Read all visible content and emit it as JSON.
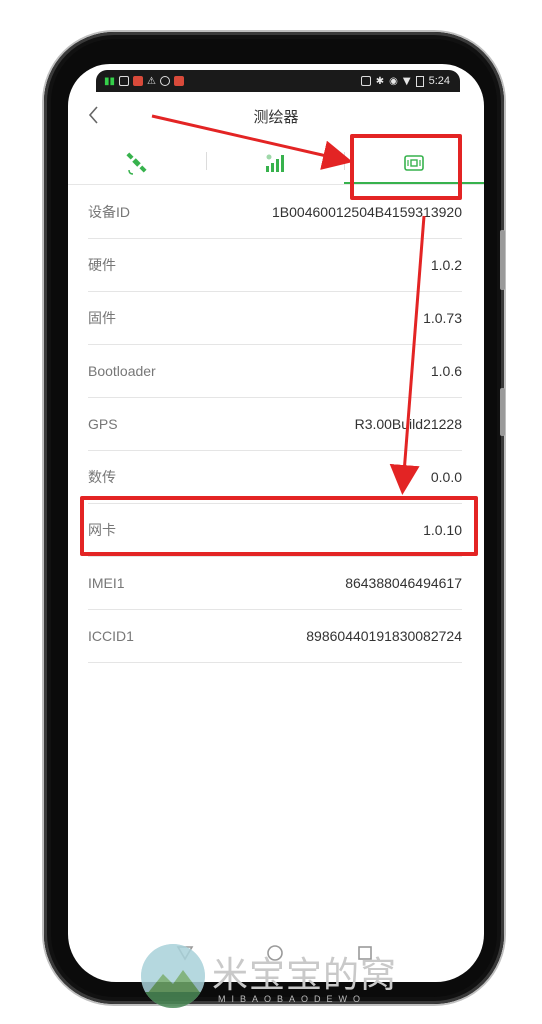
{
  "status_bar": {
    "time": "5:24",
    "left_icons": [
      "signal-icon",
      "wifi-icon",
      "notification-icon",
      "alert-icon",
      "sync-icon",
      "app-icon"
    ],
    "right_icons": [
      "nfc-icon",
      "bluetooth-icon",
      "location-icon",
      "wifi-icon",
      "battery-icon"
    ]
  },
  "header": {
    "title": "测绘器",
    "back_icon": "chevron-left-icon"
  },
  "tabs": [
    {
      "icon": "satellite-icon",
      "active": false
    },
    {
      "icon": "signal-bars-icon",
      "active": false
    },
    {
      "icon": "device-chip-icon",
      "active": true
    }
  ],
  "accent_color": "#37b24d",
  "annotation_color": "#e32424",
  "info_rows": [
    {
      "label": "设备ID",
      "value": "1B00460012504B4159313920"
    },
    {
      "label": "硬件",
      "value": "1.0.2"
    },
    {
      "label": "固件",
      "value": "1.0.73"
    },
    {
      "label": "Bootloader",
      "value": "1.0.6"
    },
    {
      "label": "GPS",
      "value": "R3.00Build21228"
    },
    {
      "label": "数传",
      "value": "0.0.0"
    },
    {
      "label": "网卡",
      "value": "1.0.10"
    },
    {
      "label": "IMEI1",
      "value": "864388046494617"
    },
    {
      "label": "ICCID1",
      "value": "89860440191830082724"
    }
  ],
  "watermark": {
    "text": "米宝宝的窝",
    "subtext": "MIBAOBAODEWO"
  }
}
